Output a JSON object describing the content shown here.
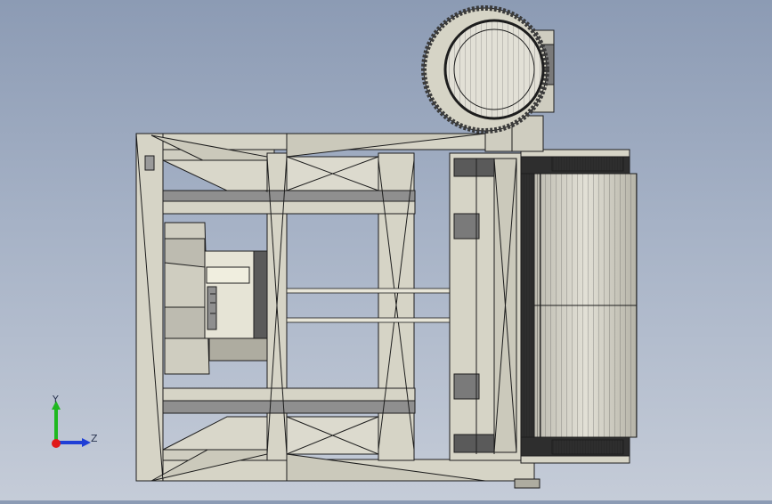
{
  "viewport": {
    "background_top": "#8c9bb4",
    "background_bottom": "#c5ccd8"
  },
  "model": {
    "frame_color": "#d6d4c6",
    "edge_color": "#1d1d1d",
    "shade_color": "#8f8f8f",
    "dark_shade": "#5a5a5a"
  },
  "triad": {
    "y_label": "Y",
    "z_label": "Z",
    "x_color": "#e01818",
    "y_color": "#1fb81f",
    "z_color": "#1f3fd6"
  }
}
